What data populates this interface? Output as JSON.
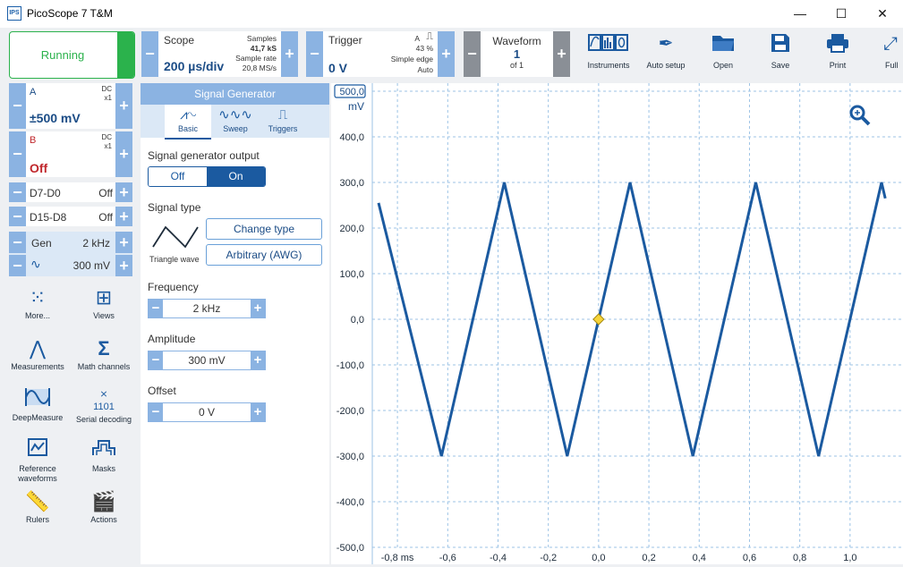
{
  "window": {
    "title": "PicoScope 7 T&M",
    "icon_text": "IPS",
    "minimize": "—",
    "maximize": "☐",
    "close": "✕"
  },
  "run": {
    "label": "Running"
  },
  "scope": {
    "label": "Scope",
    "timebase": "200 µs/div",
    "samples_label": "Samples",
    "samples": "41,7 kS",
    "rate_label": "Sample rate",
    "rate": "20,8 MS/s"
  },
  "trigger": {
    "label": "Trigger",
    "level": "0 V",
    "channel": "A",
    "percent": "43 %",
    "type": "Simple edge",
    "mode": "Auto"
  },
  "waveform": {
    "label": "Waveform",
    "index": "1",
    "of": "of 1"
  },
  "toolbar": [
    {
      "label": "Instruments",
      "icon": "instruments-icon"
    },
    {
      "label": "Auto setup",
      "icon": "auto-setup-icon"
    },
    {
      "label": "Open",
      "icon": "open-folder-icon"
    },
    {
      "label": "Save",
      "icon": "save-icon"
    },
    {
      "label": "Print",
      "icon": "print-icon"
    },
    {
      "label": "Full",
      "icon": "fullscreen-icon"
    }
  ],
  "channels": {
    "a": {
      "name": "A",
      "coupling": "DC",
      "probe": "x1",
      "range": "±500 mV"
    },
    "b": {
      "name": "B",
      "coupling": "DC",
      "probe": "x1",
      "state": "Off"
    },
    "d7": {
      "name": "D7-D0",
      "state": "Off"
    },
    "d15": {
      "name": "D15-D8",
      "state": "Off"
    },
    "gen": {
      "name": "Gen",
      "freq": "2 kHz",
      "amp": "300 mV"
    }
  },
  "left_tools": [
    {
      "label": "More...",
      "icon": "more-icon"
    },
    {
      "label": "Views",
      "icon": "views-icon"
    },
    {
      "label": "Measurements",
      "icon": "measurements-icon"
    },
    {
      "label": "Math channels",
      "icon": "math-channels-icon"
    },
    {
      "label": "DeepMeasure",
      "icon": "deepmeasure-icon"
    },
    {
      "label": "Serial decoding",
      "icon": "serial-decoding-icon"
    },
    {
      "label": "Reference waveforms",
      "icon": "reference-waveforms-icon"
    },
    {
      "label": "Masks",
      "icon": "masks-icon"
    },
    {
      "label": "Rulers",
      "icon": "rulers-icon"
    },
    {
      "label": "Actions",
      "icon": "actions-icon"
    }
  ],
  "siggen": {
    "title": "Signal Generator",
    "tabs": [
      "Basic",
      "Sweep",
      "Triggers"
    ],
    "output_label": "Signal generator output",
    "output_off": "Off",
    "output_on": "On",
    "type_label": "Signal type",
    "type_caption": "Triangle wave",
    "change_type": "Change type",
    "arbitrary": "Arbitrary (AWG)",
    "freq_label": "Frequency",
    "freq": "2 kHz",
    "amp_label": "Amplitude",
    "amp": "300 mV",
    "offset_label": "Offset",
    "offset": "0 V"
  },
  "colors": {
    "accent": "#1b5aa0",
    "running": "#2bb24c",
    "channel_b": "#c0282d",
    "panel_blue": "#8bb3e2"
  },
  "chart_data": {
    "type": "line",
    "ylabel": "mV",
    "xlabel": "",
    "ylim": [
      -500,
      500
    ],
    "xlim": [
      -0.9,
      1.15
    ],
    "y_ticks": [
      "500,0",
      "400,0",
      "300,0",
      "200,0",
      "100,0",
      "0,0",
      "-100,0",
      "-200,0",
      "-300,0",
      "-400,0",
      "-500,0"
    ],
    "x_ticks": [
      "-0,8 ms",
      "-0,6",
      "-0,4",
      "-0,2",
      "0,0",
      "0,2",
      "0,4",
      "0,6",
      "0,8",
      "1,0"
    ],
    "grid": true,
    "series": [
      {
        "x": [
          -0.875,
          -0.625,
          -0.375,
          -0.125,
          0.125,
          0.375,
          0.625,
          0.875,
          1.125,
          1.14
        ],
        "y": [
          255,
          -300,
          300,
          -300,
          300,
          -300,
          300,
          -300,
          300,
          265
        ]
      }
    ],
    "trigger_marker": {
      "x": 0.0,
      "y": 0.0
    }
  }
}
